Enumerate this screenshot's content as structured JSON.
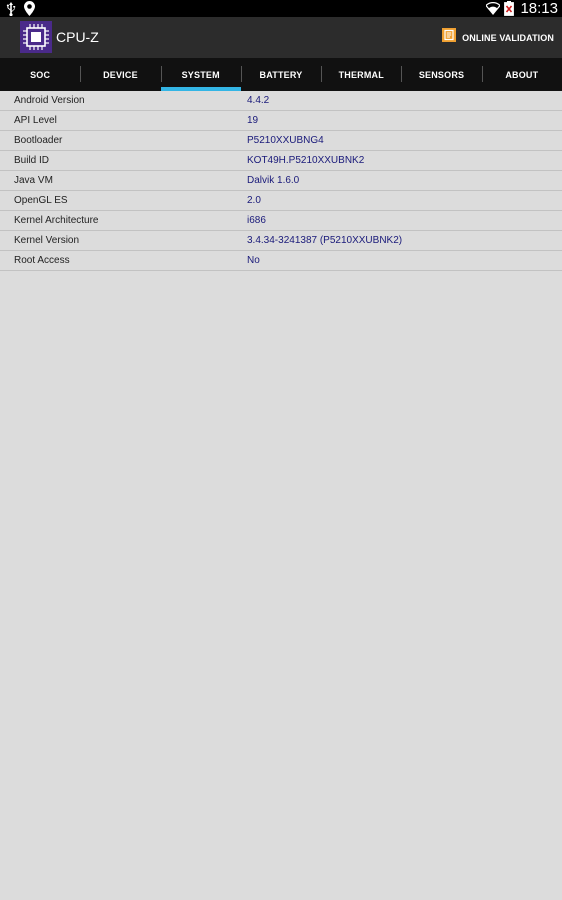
{
  "status_bar": {
    "time": "18:13",
    "icons": [
      "usb-icon",
      "location-pin-icon",
      "wifi-icon",
      "battery-icon"
    ]
  },
  "action_bar": {
    "title": "CPU-Z",
    "validation_label": "ONLINE VALIDATION",
    "accent_color": "#f0a030"
  },
  "tabs": [
    {
      "label": "SOC",
      "active": false
    },
    {
      "label": "DEVICE",
      "active": false
    },
    {
      "label": "SYSTEM",
      "active": true
    },
    {
      "label": "BATTERY",
      "active": false
    },
    {
      "label": "THERMAL",
      "active": false
    },
    {
      "label": "SENSORS",
      "active": false
    },
    {
      "label": "ABOUT",
      "active": false
    }
  ],
  "system_info": [
    {
      "label": "Android Version",
      "value": "4.4.2"
    },
    {
      "label": "API Level",
      "value": "19"
    },
    {
      "label": "Bootloader",
      "value": "P5210XXUBNG4"
    },
    {
      "label": "Build ID",
      "value": "KOT49H.P5210XXUBNK2"
    },
    {
      "label": "Java VM",
      "value": "Dalvik 1.6.0"
    },
    {
      "label": "OpenGL ES",
      "value": "2.0"
    },
    {
      "label": "Kernel Architecture",
      "value": "i686"
    },
    {
      "label": "Kernel Version",
      "value": "3.4.34-3241387 (P5210XXUBNK2)"
    },
    {
      "label": "Root Access",
      "value": "No"
    }
  ],
  "colors": {
    "tab_indicator": "#33b5e5",
    "value_text": "#1a1a7a",
    "background": "#dcdcdc"
  }
}
